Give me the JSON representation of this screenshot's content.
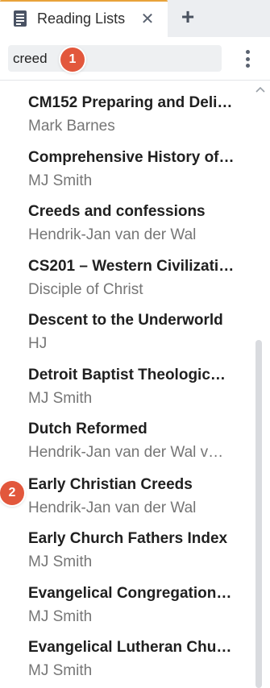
{
  "tab": {
    "title": "Reading Lists",
    "icon": "reading-list-icon",
    "close_symbol": "✕",
    "add_symbol": "+"
  },
  "search": {
    "value": "creed"
  },
  "callouts": [
    "1",
    "2"
  ],
  "items": [
    {
      "title": "CM152 Preparing and Deli…",
      "author": "Mark Barnes"
    },
    {
      "title": "Comprehensive History of…",
      "author": "MJ Smith"
    },
    {
      "title": "Creeds and confessions",
      "author": "Hendrik-Jan van der Wal"
    },
    {
      "title": "CS201 –  Western Civilizati…",
      "author": "Disciple of Christ"
    },
    {
      "title": "Descent to the Underworld",
      "author": "HJ"
    },
    {
      "title": "Detroit Baptist Theologic…",
      "author": "MJ Smith"
    },
    {
      "title": "Dutch Reformed",
      "author": "Hendrik-Jan van der Wal  v…"
    },
    {
      "title": "Early Christian Creeds",
      "author": "Hendrik-Jan van der Wal"
    },
    {
      "title": "Early Church Fathers Index",
      "author": "MJ Smith"
    },
    {
      "title": "Evangelical Congregation…",
      "author": "MJ Smith"
    },
    {
      "title": "Evangelical Lutheran Chu…",
      "author": "MJ Smith"
    }
  ],
  "colors": {
    "accent_tab": "#e8a33a",
    "callout": "#e2573c"
  }
}
